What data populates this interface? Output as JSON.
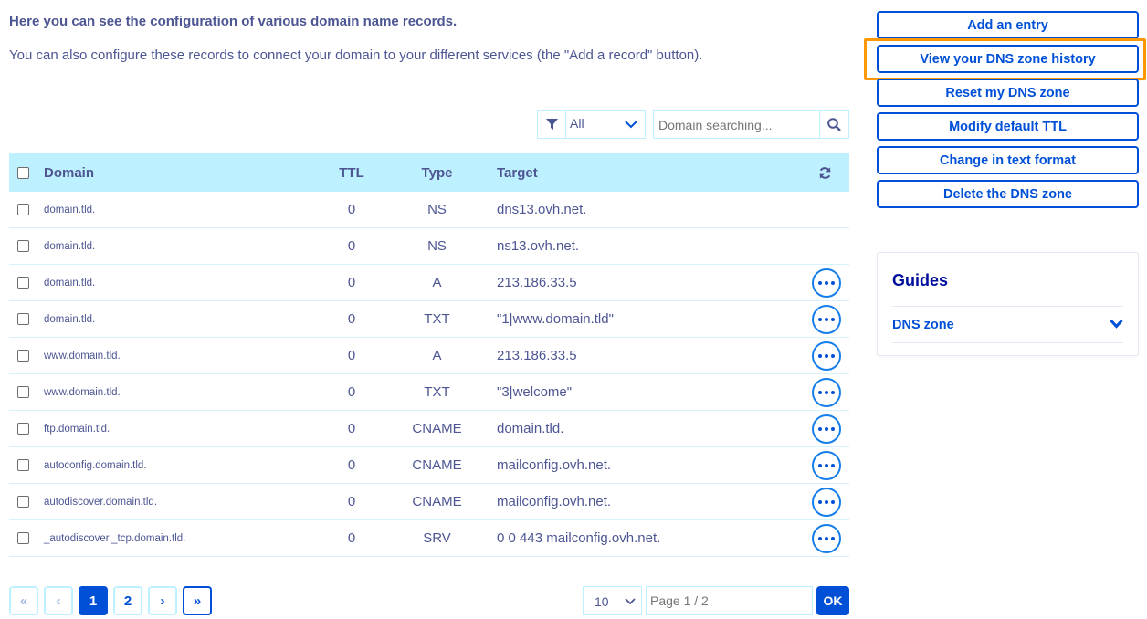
{
  "intro": {
    "heading": "Here you can see the configuration of various domain name records.",
    "text": "You can also configure these records to connect your domain to your different services (the \"Add a record\" button)."
  },
  "filter": {
    "selected": "All",
    "search_placeholder": "Domain searching..."
  },
  "table": {
    "headers": {
      "domain": "Domain",
      "ttl": "TTL",
      "type": "Type",
      "target": "Target"
    },
    "rows": [
      {
        "domain": "domain.tld.",
        "ttl": "0",
        "type": "NS",
        "target": "dns13.ovh.net.",
        "has_actions": false
      },
      {
        "domain": "domain.tld.",
        "ttl": "0",
        "type": "NS",
        "target": "ns13.ovh.net.",
        "has_actions": false
      },
      {
        "domain": "domain.tld.",
        "ttl": "0",
        "type": "A",
        "target": "213.186.33.5",
        "has_actions": true
      },
      {
        "domain": "domain.tld.",
        "ttl": "0",
        "type": "TXT",
        "target": "\"1|www.domain.tld\"",
        "has_actions": true
      },
      {
        "domain": "www.domain.tld.",
        "ttl": "0",
        "type": "A",
        "target": "213.186.33.5",
        "has_actions": true
      },
      {
        "domain": "www.domain.tld.",
        "ttl": "0",
        "type": "TXT",
        "target": "\"3|welcome\"",
        "has_actions": true
      },
      {
        "domain": "ftp.domain.tld.",
        "ttl": "0",
        "type": "CNAME",
        "target": "domain.tld.",
        "has_actions": true
      },
      {
        "domain": "autoconfig.domain.tld.",
        "ttl": "0",
        "type": "CNAME",
        "target": "mailconfig.ovh.net.",
        "has_actions": true
      },
      {
        "domain": "autodiscover.domain.tld.",
        "ttl": "0",
        "type": "CNAME",
        "target": "mailconfig.ovh.net.",
        "has_actions": true
      },
      {
        "domain": "_autodiscover._tcp.domain.tld.",
        "ttl": "0",
        "type": "SRV",
        "target": "0 0 443 mailconfig.ovh.net.",
        "has_actions": true
      }
    ]
  },
  "pagination": {
    "first": "«",
    "prev": "‹",
    "pages": [
      "1",
      "2"
    ],
    "current": "1",
    "next": "›",
    "last": "»",
    "page_size": "10",
    "page_placeholder": "Page 1 / 2",
    "ok": "OK"
  },
  "actions": {
    "add_entry": "Add an entry",
    "view_history": "View your DNS zone history",
    "reset_zone": "Reset my DNS zone",
    "modify_ttl": "Modify default TTL",
    "text_format": "Change in text format",
    "delete_zone": "Delete the DNS zone"
  },
  "guides": {
    "title": "Guides",
    "item": "DNS zone"
  },
  "colors": {
    "accent": "#0050d7",
    "header_bg": "#bef1ff",
    "highlight": "#ff9803",
    "text": "#4d5693"
  },
  "icons": [
    "filter-icon",
    "chevron-down-icon",
    "search-icon",
    "refresh-icon",
    "more-options-icon"
  ]
}
